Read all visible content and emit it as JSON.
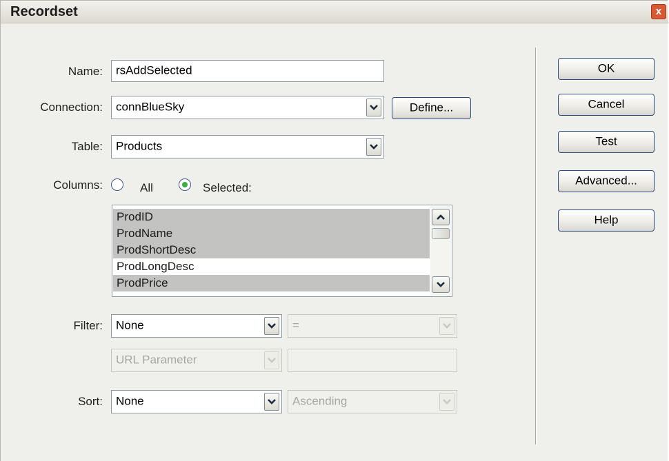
{
  "window": {
    "title": "Recordset",
    "close_glyph": "x"
  },
  "form": {
    "name_label": "Name:",
    "name_value": "rsAddSelected",
    "connection_label": "Connection:",
    "connection_value": "connBlueSky",
    "define_label": "Define...",
    "table_label": "Table:",
    "table_value": "Products",
    "columns_label": "Columns:",
    "radio_all_label": "All",
    "radio_selected_label": "Selected:",
    "columns_selected": "selected",
    "columns_list": [
      {
        "label": "ProdID",
        "selected": true
      },
      {
        "label": "ProdName",
        "selected": true
      },
      {
        "label": "ProdShortDesc",
        "selected": true
      },
      {
        "label": "ProdLongDesc",
        "selected": false
      },
      {
        "label": "ProdPrice",
        "selected": true
      }
    ],
    "filter_label": "Filter:",
    "filter_value": "None",
    "filter_operator": "=",
    "filter_param_type": "URL Parameter",
    "filter_param_value": "",
    "sort_label": "Sort:",
    "sort_value": "None",
    "sort_order": "Ascending"
  },
  "buttons": {
    "ok": "OK",
    "cancel": "Cancel",
    "test": "Test",
    "advanced": "Advanced...",
    "help": "Help"
  },
  "icons": {
    "dropdown": "chevron-down-icon",
    "scroll_up": "chevron-up-icon",
    "scroll_down": "chevron-down-icon",
    "close": "close-icon"
  },
  "colors": {
    "dialog_bg": "#efefeb",
    "selection": "#c3c3c1",
    "radio_dot": "#3fae42",
    "button_border": "#2b4a7e"
  }
}
